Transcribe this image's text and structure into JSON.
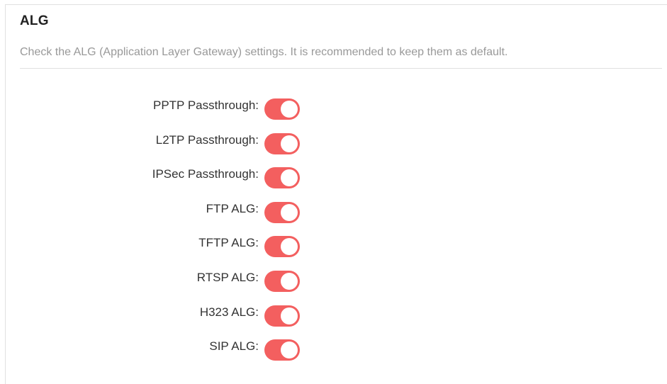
{
  "section": {
    "title": "ALG",
    "description": "Check the ALG (Application Layer Gateway) settings. It is recommended to keep them as default."
  },
  "accent_color": "#f35f5f",
  "settings": [
    {
      "label": "PPTP Passthrough:",
      "enabled": true
    },
    {
      "label": "L2TP Passthrough:",
      "enabled": true
    },
    {
      "label": "IPSec Passthrough:",
      "enabled": true
    },
    {
      "label": "FTP ALG:",
      "enabled": true
    },
    {
      "label": "TFTP ALG:",
      "enabled": true
    },
    {
      "label": "RTSP ALG:",
      "enabled": true
    },
    {
      "label": "H323 ALG:",
      "enabled": true
    },
    {
      "label": "SIP ALG:",
      "enabled": true
    }
  ]
}
